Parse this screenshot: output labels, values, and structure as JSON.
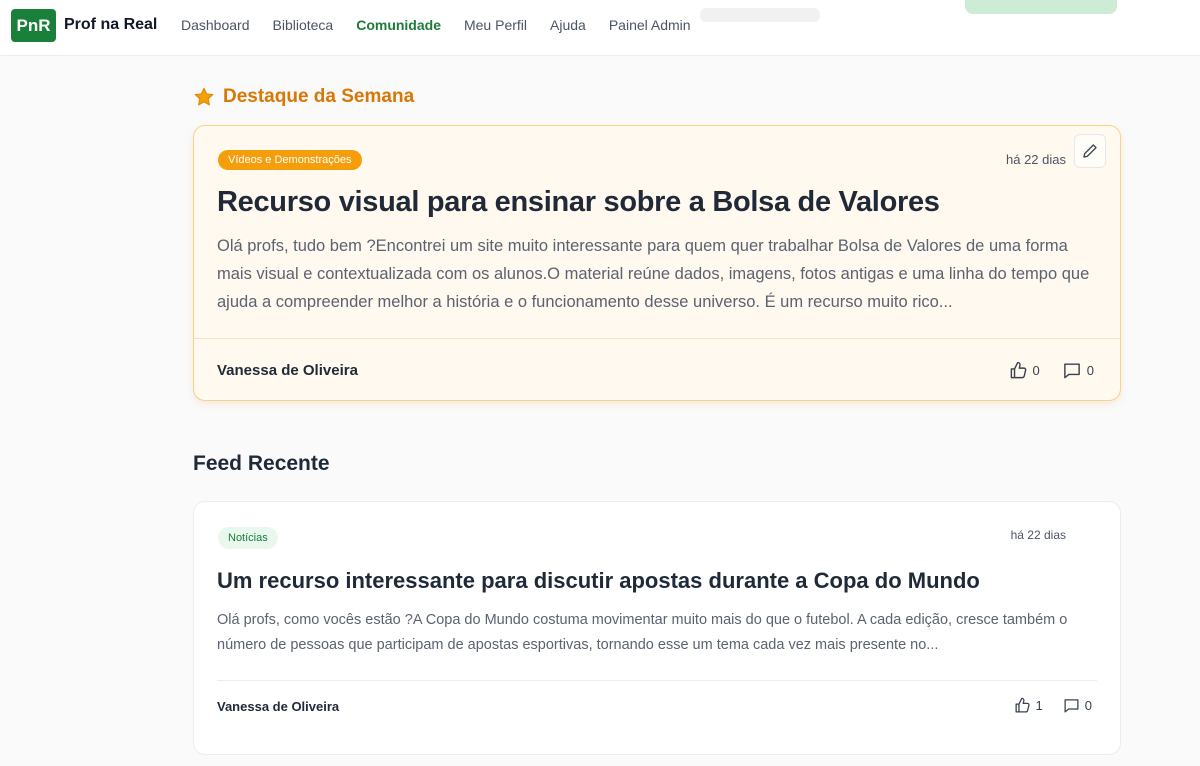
{
  "header": {
    "logo_text": "PnR",
    "brand": "Prof na Real",
    "nav": [
      {
        "label": "Dashboard",
        "active": false
      },
      {
        "label": "Biblioteca",
        "active": false
      },
      {
        "label": "Comunidade",
        "active": true
      },
      {
        "label": "Meu Perfil",
        "active": false
      },
      {
        "label": "Ajuda",
        "active": false
      },
      {
        "label": "Painel Admin",
        "active": false
      }
    ]
  },
  "featured": {
    "section_title": "Destaque da Semana",
    "icon": "star-icon",
    "category": "Vídeos e Demonstrações",
    "date": "há 22 dias",
    "title": "Recurso visual para ensinar sobre a Bolsa de Valores",
    "excerpt": "Olá profs, tudo bem ?Encontrei um site muito interessante para quem quer trabalhar Bolsa de Valores de uma forma mais visual e contextualizada com os alunos.O material reúne dados, imagens, fotos antigas e uma linha do tempo que ajuda a compreender melhor a história e o funcionamento desse universo. É um recurso muito rico...",
    "author": "Vanessa de Oliveira",
    "likes": "0",
    "comments": "0"
  },
  "feed": {
    "section_title": "Feed Recente",
    "posts": [
      {
        "category": "Notícias",
        "date": "há 22 dias",
        "title": "Um recurso interessante para discutir apostas durante a Copa do Mundo",
        "excerpt": "Olá profs, como vocês estão ?A Copa do Mundo costuma movimentar muito mais do que o futebol. A cada edição, cresce também o número de pessoas que participam de apostas esportivas, tornando esse um tema cada vez mais presente no...",
        "author": "Vanessa de Oliveira",
        "likes": "1",
        "comments": "0"
      }
    ]
  },
  "colors": {
    "brand_green": "#188038",
    "accent_orange": "#f59e0b",
    "featured_bg": "#fff9ef"
  }
}
